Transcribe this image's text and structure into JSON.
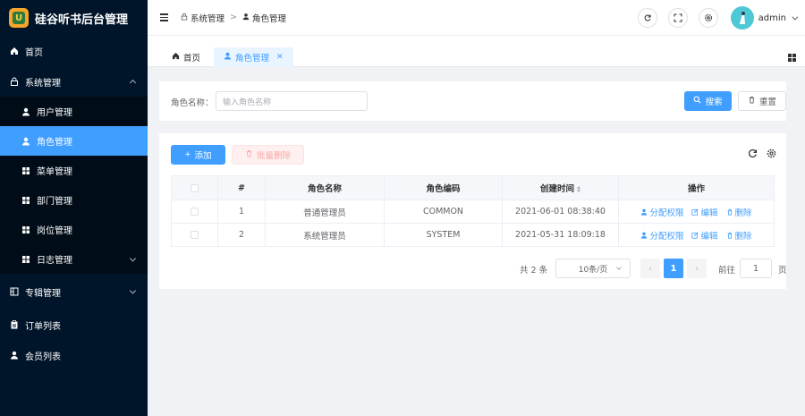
{
  "app": {
    "title": "硅谷听书后台管理",
    "logo_letter": "U"
  },
  "sidebar": {
    "items": [
      {
        "label": "首页",
        "icon": "home-icon"
      },
      {
        "label": "系统管理",
        "icon": "lock-icon"
      },
      {
        "label": "用户管理",
        "icon": "user-icon"
      },
      {
        "label": "角色管理",
        "icon": "user-icon"
      },
      {
        "label": "菜单管理",
        "icon": "grid-icon"
      },
      {
        "label": "部门管理",
        "icon": "grid-icon"
      },
      {
        "label": "岗位管理",
        "icon": "grid-icon"
      },
      {
        "label": "日志管理",
        "icon": "grid-icon"
      },
      {
        "label": "专辑管理",
        "icon": "album-icon"
      },
      {
        "label": "订单列表",
        "icon": "clipboard-icon"
      },
      {
        "label": "会员列表",
        "icon": "user-icon"
      }
    ]
  },
  "header": {
    "breadcrumb": [
      "系统管理",
      "角色管理"
    ],
    "username": "admin"
  },
  "tabs": [
    {
      "label": "首页"
    },
    {
      "label": "角色管理",
      "active": true
    }
  ],
  "search": {
    "label": "角色名称：",
    "placeholder": "输入角色名称",
    "search_label": "搜索",
    "reset_label": "重置"
  },
  "toolbar": {
    "add_label": "添加",
    "batch_delete_label": "批量删除"
  },
  "table": {
    "columns": [
      "#",
      "角色名称",
      "角色编码",
      "创建时间",
      "操作"
    ],
    "rows": [
      {
        "index": "1",
        "name": "普通管理员",
        "code": "COMMON",
        "created": "2021-06-01 08:38:40"
      },
      {
        "index": "2",
        "name": "系统管理员",
        "code": "SYSTEM",
        "created": "2021-05-31 18:09:18"
      }
    ],
    "actions": {
      "assign": "分配权限",
      "edit": "编辑",
      "delete": "删除"
    }
  },
  "pagination": {
    "total_text": "共 2 条",
    "page_size": "10条/页",
    "current_page": "1",
    "jump_label": "前往",
    "jump_value": "1",
    "jump_unit": "页"
  },
  "colors": {
    "sidebar_bg": "#001529",
    "primary": "#409eff",
    "danger_disabled": "#fef0f0"
  }
}
